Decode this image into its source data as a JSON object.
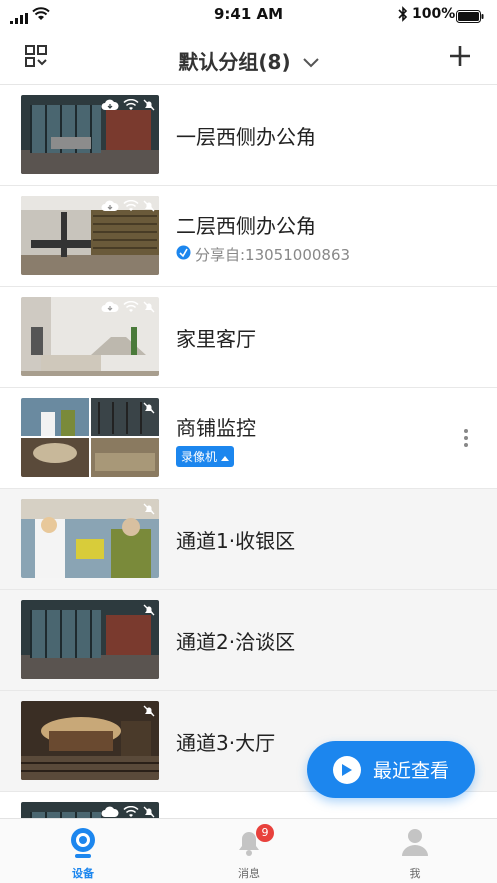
{
  "status_bar": {
    "time": "9:41 AM",
    "battery": "100%"
  },
  "nav": {
    "title": "默认分组(8)"
  },
  "colors": {
    "accent": "#1c86ee",
    "badge_red": "#e8413c"
  },
  "devices": [
    {
      "title": "一层西侧办公角",
      "subtitle": "",
      "badge": "",
      "icons": [
        "cloud-icon",
        "wifi-icon",
        "mute-icon"
      ]
    },
    {
      "title": "二层西侧办公角",
      "subtitle": "分享自:13051000863",
      "badge": "",
      "icons": [
        "cloud-icon",
        "wifi-icon",
        "mute-icon"
      ]
    },
    {
      "title": "家里客厅",
      "subtitle": "",
      "badge": "",
      "icons": [
        "cloud-icon",
        "wifi-icon",
        "mute-icon"
      ]
    },
    {
      "title": "商铺监控",
      "subtitle": "",
      "badge": "录像机",
      "icons": [
        "mute-icon"
      ]
    },
    {
      "title": "通道1·收银区",
      "subtitle": "",
      "badge": "",
      "icons": [
        "mute-icon"
      ]
    },
    {
      "title": "通道2·洽谈区",
      "subtitle": "",
      "badge": "",
      "icons": [
        "mute-icon"
      ]
    },
    {
      "title": "通道3·大厅",
      "subtitle": "",
      "badge": "",
      "icons": [
        "mute-icon"
      ]
    }
  ],
  "fab": {
    "label": "最近查看"
  },
  "tabs": [
    {
      "label": "设备",
      "active": true
    },
    {
      "label": "消息",
      "badge_count": "9"
    },
    {
      "label": "我"
    }
  ]
}
